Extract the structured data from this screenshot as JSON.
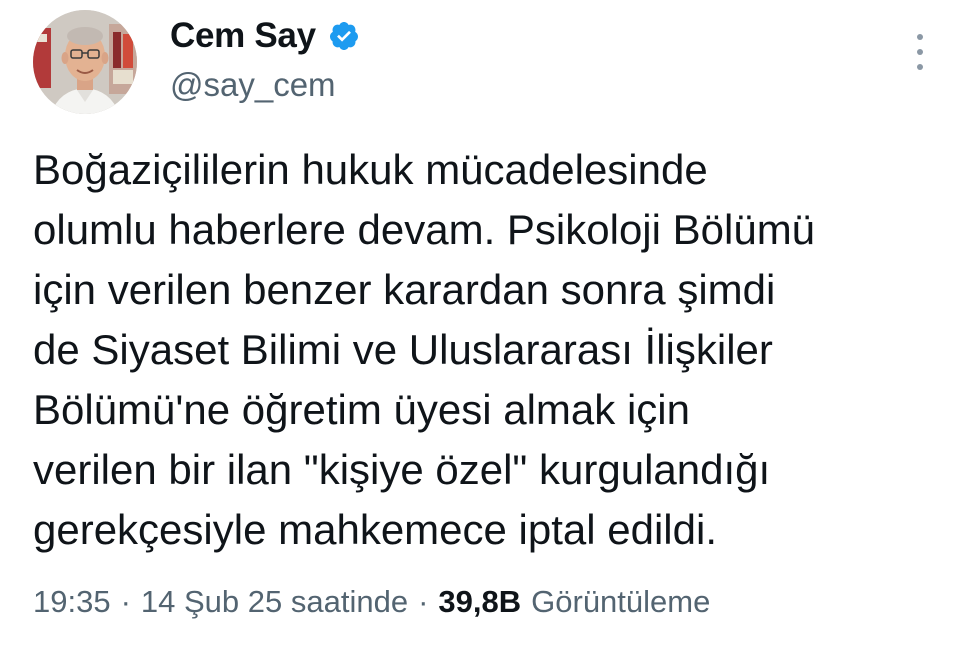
{
  "author": {
    "display_name": "Cem Say",
    "handle": "@say_cem",
    "verified": true,
    "verified_color": "#1d9bf0"
  },
  "tweet": {
    "text_lines": [
      "Boğaziçililerin hukuk mücadelesinde",
      "olumlu haberlere devam. Psikoloji Bölümü",
      "için verilen benzer karardan sonra şimdi",
      "de Siyaset Bilimi ve Uluslararası İlişkiler",
      "Bölümü'ne öğretim üyesi almak için",
      "verilen bir ilan \"kişiye özel\" kurgulandığı",
      "gerekçesiyle mahkemece iptal edildi."
    ]
  },
  "meta": {
    "time": "19:35",
    "separator": "·",
    "date": "14 Şub 25 saatinde",
    "views_count": "39,8B",
    "views_label": "Görüntüleme"
  },
  "icons": {
    "more": "more-vertical-icon",
    "verified": "verified-badge-icon"
  }
}
